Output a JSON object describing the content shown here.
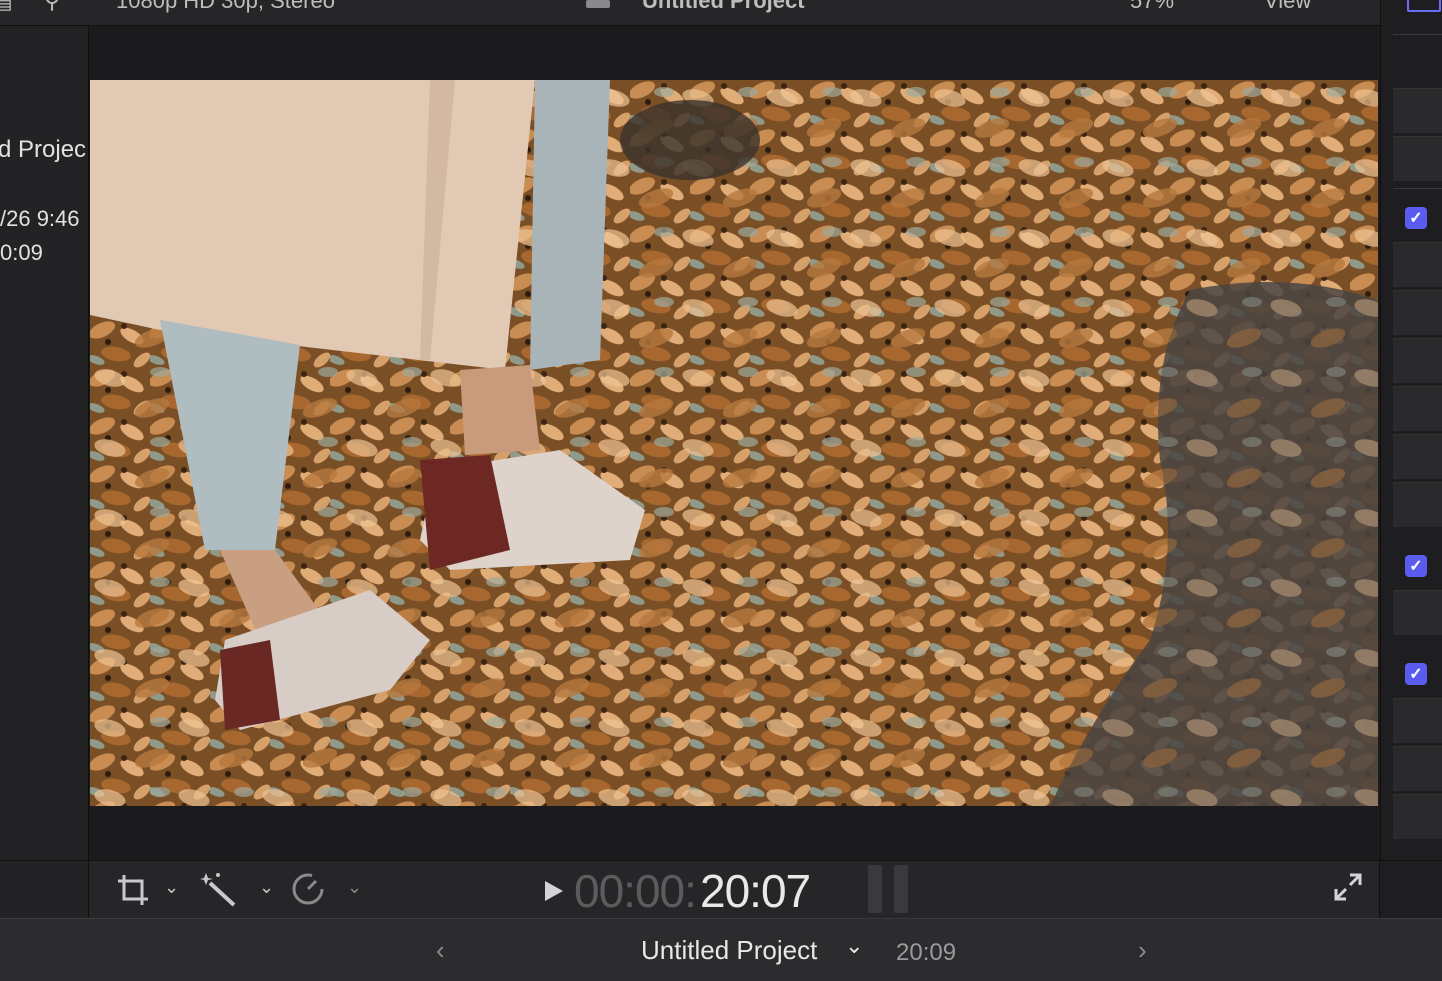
{
  "top_bar": {
    "format_text": "1080p HD 30p, Stereo",
    "title": "Untitled Project",
    "zoom": "57%",
    "view_label": "View"
  },
  "browser": {
    "project_name": "d Projec",
    "date_modified": "/26 9:46",
    "duration": "0:09"
  },
  "viewer": {
    "timecode_dim": "00:00:",
    "timecode_bright": "20:07",
    "frame_icon": "leaves-video-frame"
  },
  "tools": {
    "transform": "crop-transform-icon",
    "enhance": "magic-wand-icon",
    "retime": "speedometer-icon",
    "play": "play-icon",
    "fullscreen": "expand-icon"
  },
  "timeline": {
    "project_name": "Untitled Project",
    "duration": "20:09"
  },
  "colors": {
    "accent": "#5a5cf0",
    "background": "#1c1c1e"
  }
}
